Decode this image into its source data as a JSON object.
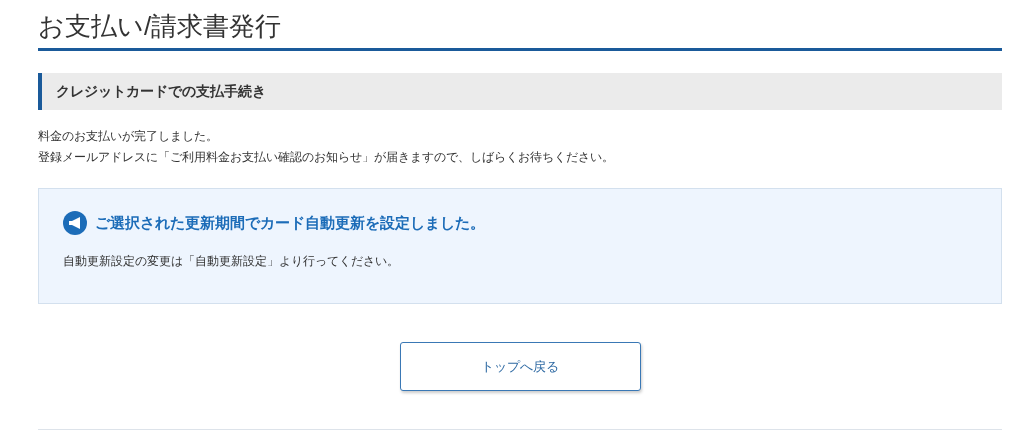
{
  "page_title": "お支払い/請求書発行",
  "section_heading": "クレジットカードでの支払手続き",
  "messages": [
    "料金のお支払いが完了しました。",
    "登録メールアドレスに「ご利用料金お支払い確認のお知らせ」が届きますので、しばらくお待ちください。"
  ],
  "notice": {
    "title": "ご選択された更新期間でカード自動更新を設定しました。",
    "body": "自動更新設定の変更は「自動更新設定」より行ってください。"
  },
  "button": "トップへ戻る"
}
